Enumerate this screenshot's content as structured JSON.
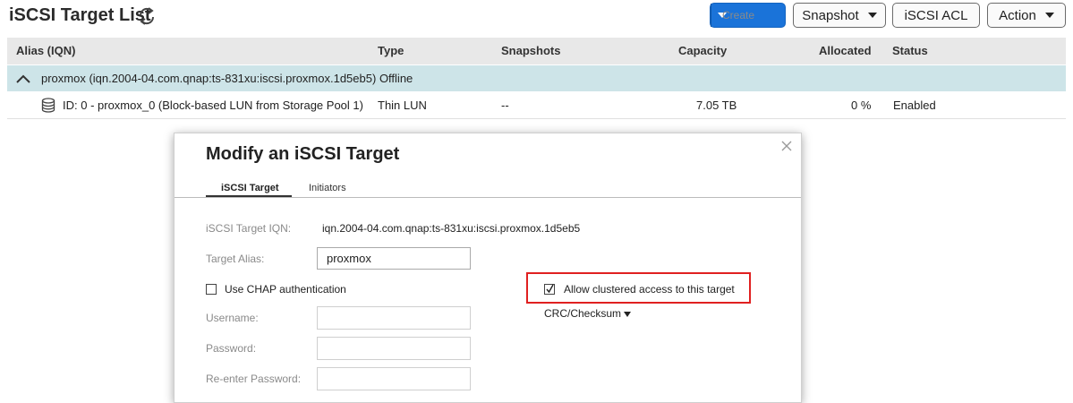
{
  "page": {
    "title": "iSCSI Target List"
  },
  "toolbar": {
    "create": "Create",
    "snapshot": "Snapshot",
    "iscsi_acl": "iSCSI ACL",
    "action": "Action"
  },
  "table": {
    "columns": [
      "Alias (IQN)",
      "Type",
      "Snapshots",
      "Capacity",
      "Allocated",
      "Status"
    ],
    "group": {
      "alias": "proxmox (iqn.2004-04.com.qnap:ts-831xu:iscsi.proxmox.1d5eb5)",
      "status": "Offline"
    },
    "rows": [
      {
        "alias": "ID: 0 - proxmox_0 (Block-based LUN from Storage Pool 1)",
        "type": "Thin LUN",
        "snapshots": "--",
        "capacity": "7.05 TB",
        "allocated": "0 %",
        "status": "Enabled"
      }
    ]
  },
  "dialog": {
    "title": "Modify an iSCSI Target",
    "tabs": [
      "iSCSI Target",
      "Initiators"
    ],
    "iqn_label": "iSCSI Target IQN:",
    "iqn_value": "iqn.2004-04.com.qnap:ts-831xu:iscsi.proxmox.1d5eb5",
    "alias_label": "Target Alias:",
    "alias_value": "proxmox",
    "chap_label": "Use CHAP authentication",
    "chap_checked": false,
    "username_label": "Username:",
    "password_label": "Password:",
    "reenter_label": "Re-enter Password:",
    "cluster_label": "Allow clustered access to this target",
    "cluster_checked": true,
    "crc_label": "CRC/Checksum"
  },
  "colors": {
    "accent": "#1a73d9",
    "highlight": "#e02020",
    "group_row": "#cde4e8",
    "header_row": "#e8e8e8"
  },
  "icons": [
    "refresh-icon",
    "chevron-up-icon",
    "database-icon",
    "close-icon",
    "check-icon",
    "chevron-down-icon"
  ]
}
